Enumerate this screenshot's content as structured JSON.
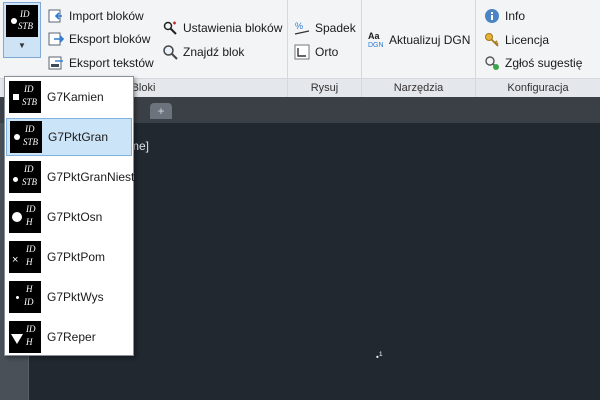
{
  "ribbon": {
    "bloki": {
      "title": "Bloki",
      "items": [
        {
          "label": "Import bloków",
          "icon": "import-icon"
        },
        {
          "label": "Eksport bloków",
          "icon": "export-icon"
        },
        {
          "label": "Eksport tekstów",
          "icon": "export-text-icon"
        },
        {
          "label": "Ustawienia bloków",
          "icon": "block-settings-icon"
        },
        {
          "label": "Znajdź blok",
          "icon": "find-icon"
        }
      ]
    },
    "rysuj": {
      "title": "Rysuj",
      "items": [
        {
          "label": "Spadek",
          "icon": "slope-icon"
        },
        {
          "label": "Orto",
          "icon": "ortho-icon"
        }
      ]
    },
    "narzedzia": {
      "title": "Narzędzia",
      "items": [
        {
          "label": "Aktualizuj DGN",
          "icon": "update-dgn-icon",
          "icon_text": "Aa",
          "icon_sub": "DGN"
        }
      ]
    },
    "konfiguracja": {
      "title": "Konfiguracja",
      "items": [
        {
          "label": "Info",
          "icon": "info-icon"
        },
        {
          "label": "Licencja",
          "icon": "key-icon"
        },
        {
          "label": "Zgłoś sugestię",
          "icon": "suggestion-icon"
        }
      ]
    }
  },
  "main_block": {
    "top": "ID",
    "bottom": "STB"
  },
  "dropdown": {
    "selected": "G7PktGran",
    "items": [
      {
        "label": "G7Kamien",
        "line1": "ID",
        "line2": "STB"
      },
      {
        "label": "G7PktGran",
        "line1": "ID",
        "line2": "STB"
      },
      {
        "label": "G7PktGranNiest",
        "line1": "ID",
        "line2": "STB"
      },
      {
        "label": "G7PktOsn",
        "line1": "ID",
        "line2": "H"
      },
      {
        "label": "G7PktPom",
        "line1": "ID",
        "line2": "H"
      },
      {
        "label": "G7PktWys",
        "line1": "H",
        "line2": "ID"
      },
      {
        "label": "G7Reper",
        "line1": "ID",
        "line2": "H"
      }
    ]
  },
  "canvas": {
    "text": "me]",
    "cursor_mark": "1"
  },
  "tabs": {
    "add_symbol": "+"
  }
}
